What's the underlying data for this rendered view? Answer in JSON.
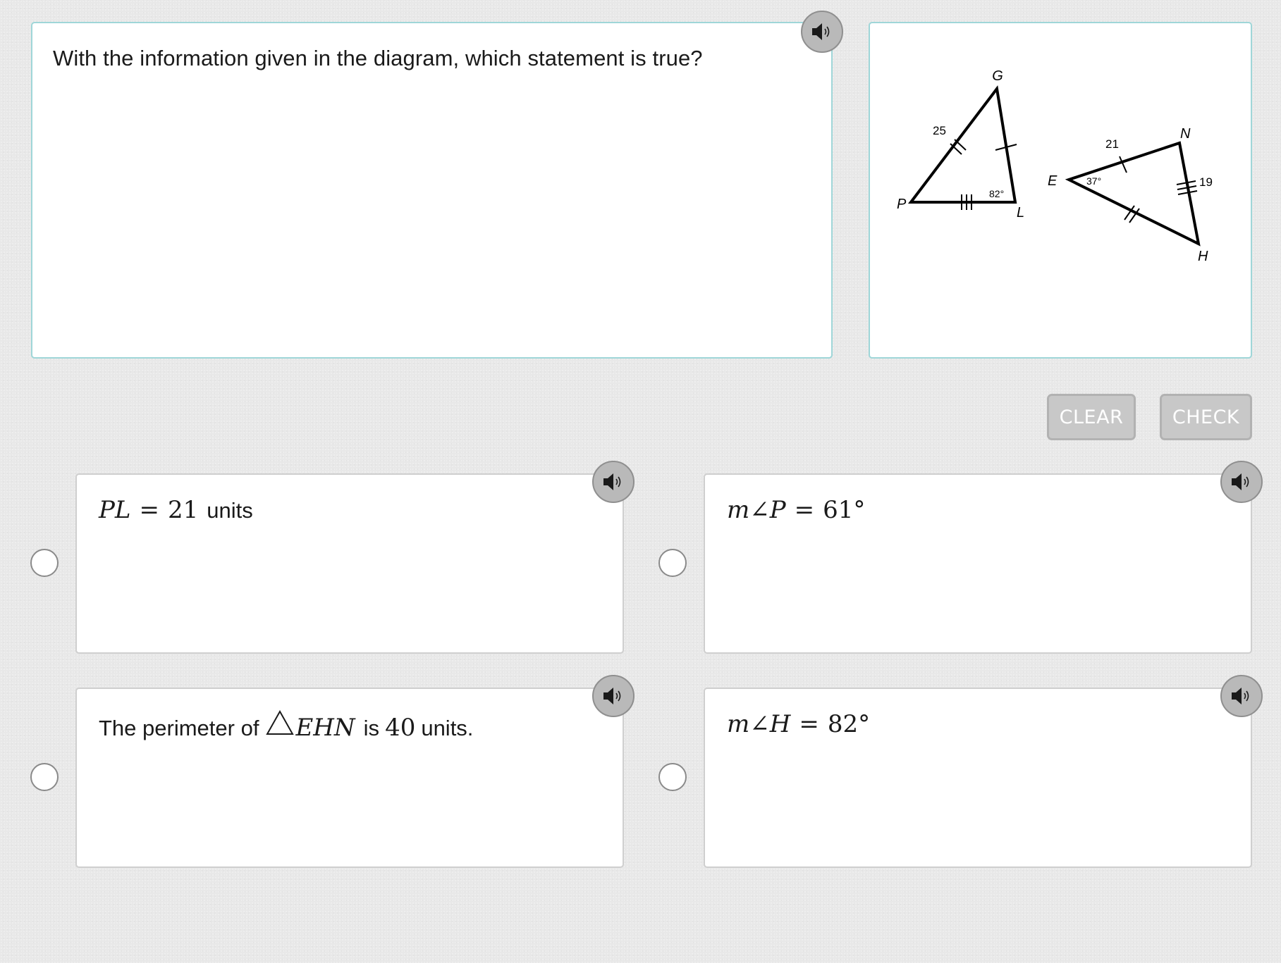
{
  "question": {
    "text": "With the information given in the diagram, which statement is true?"
  },
  "figure": {
    "triangle_1": {
      "vertices": [
        "G",
        "P",
        "L"
      ],
      "side_label": "25",
      "angle_label": "82°"
    },
    "triangle_2": {
      "vertices": [
        "E",
        "N",
        "H"
      ],
      "side_labels": [
        "21",
        "19"
      ],
      "angle_label": "37°"
    }
  },
  "controls": {
    "clear_label": "CLEAR",
    "check_label": "CHECK"
  },
  "choices": [
    {
      "lhs": "PL",
      "eq": "=",
      "value": "21",
      "unit": "units"
    },
    {
      "lhs_m": "m",
      "angle_sym": "∠",
      "vertex": "P",
      "eq": "=",
      "value": "61°"
    },
    {
      "prefix": "The perimeter of",
      "triangle": "EHN",
      "mid": "is",
      "value": "40",
      "suffix": "units."
    },
    {
      "lhs_m": "m",
      "angle_sym": "∠",
      "vertex": "H",
      "eq": "=",
      "value": "82°"
    }
  ],
  "icons": {
    "audio": "speaker-icon",
    "radio": "radio-button"
  }
}
